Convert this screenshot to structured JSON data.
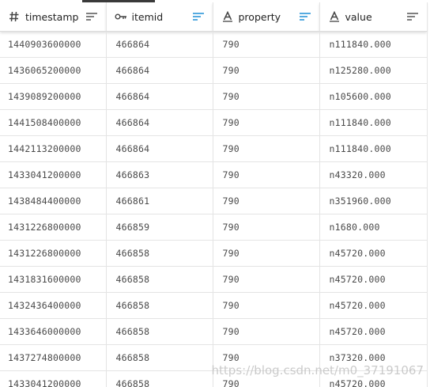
{
  "columns": [
    {
      "key": "timestamp",
      "label": "timestamp",
      "type_icon": "hash-icon"
    },
    {
      "key": "itemid",
      "label": "itemid",
      "type_icon": "key-icon"
    },
    {
      "key": "property",
      "label": "property",
      "type_icon": "text-type-icon"
    },
    {
      "key": "value",
      "label": "value",
      "type_icon": "text-type-icon"
    }
  ],
  "colors": {
    "sort_active": "#1f8fd6",
    "sort_inactive": "#555555",
    "text": "#4a4a4a",
    "header_text": "#222222",
    "grid": "#e4e4e4"
  },
  "rows": [
    {
      "timestamp": "1440903600000",
      "itemid": "466864",
      "property": "790",
      "value": "n111840.000"
    },
    {
      "timestamp": "1436065200000",
      "itemid": "466864",
      "property": "790",
      "value": "n125280.000"
    },
    {
      "timestamp": "1439089200000",
      "itemid": "466864",
      "property": "790",
      "value": "n105600.000"
    },
    {
      "timestamp": "1441508400000",
      "itemid": "466864",
      "property": "790",
      "value": "n111840.000"
    },
    {
      "timestamp": "1442113200000",
      "itemid": "466864",
      "property": "790",
      "value": "n111840.000"
    },
    {
      "timestamp": "1433041200000",
      "itemid": "466863",
      "property": "790",
      "value": "n43320.000"
    },
    {
      "timestamp": "1438484400000",
      "itemid": "466861",
      "property": "790",
      "value": "n351960.000"
    },
    {
      "timestamp": "1431226800000",
      "itemid": "466859",
      "property": "790",
      "value": "n1680.000"
    },
    {
      "timestamp": "1431226800000",
      "itemid": "466858",
      "property": "790",
      "value": "n45720.000"
    },
    {
      "timestamp": "1431831600000",
      "itemid": "466858",
      "property": "790",
      "value": "n45720.000"
    },
    {
      "timestamp": "1432436400000",
      "itemid": "466858",
      "property": "790",
      "value": "n45720.000"
    },
    {
      "timestamp": "1433646000000",
      "itemid": "466858",
      "property": "790",
      "value": "n45720.000"
    },
    {
      "timestamp": "1437274800000",
      "itemid": "466858",
      "property": "790",
      "value": "n37320.000"
    },
    {
      "timestamp": "1433041200000",
      "itemid": "466858",
      "property": "790",
      "value": "n45720.000"
    }
  ],
  "watermark": "https://blog.csdn.net/m0_37191067"
}
